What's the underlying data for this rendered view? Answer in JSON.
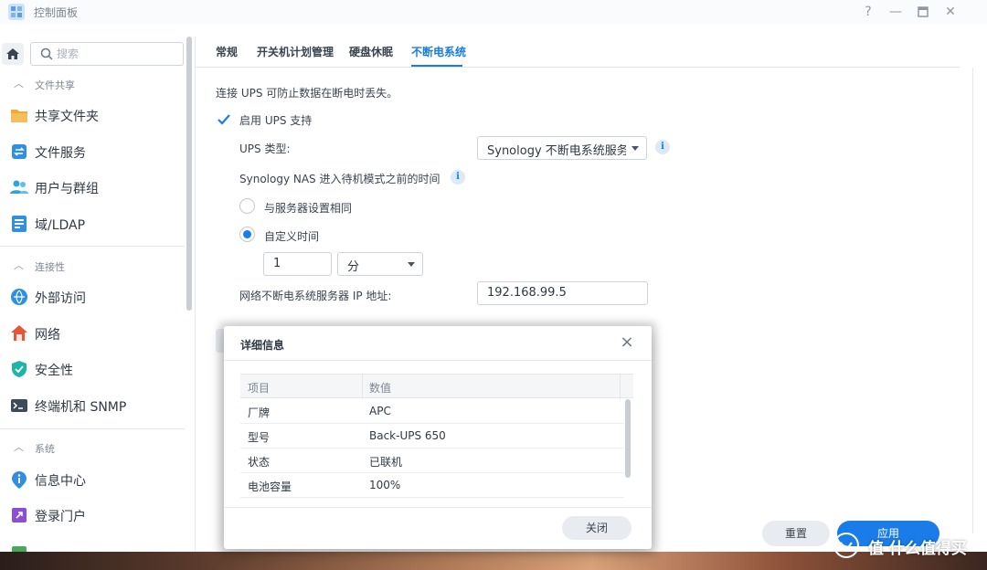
{
  "window": {
    "title": "控制面板"
  },
  "sidebar": {
    "search_placeholder": "搜索",
    "sections": [
      {
        "title": "文件共享",
        "items": [
          {
            "label": "共享文件夹",
            "icon": "folder-share-icon"
          },
          {
            "label": "文件服务",
            "icon": "file-services-icon"
          },
          {
            "label": "用户与群组",
            "icon": "users-group-icon"
          },
          {
            "label": "域/LDAP",
            "icon": "domain-ldap-icon"
          }
        ]
      },
      {
        "title": "连接性",
        "items": [
          {
            "label": "外部访问",
            "icon": "external-access-icon"
          },
          {
            "label": "网络",
            "icon": "network-icon"
          },
          {
            "label": "安全性",
            "icon": "shield-icon"
          },
          {
            "label": "终端机和 SNMP",
            "icon": "terminal-icon"
          }
        ]
      },
      {
        "title": "系统",
        "items": [
          {
            "label": "信息中心",
            "icon": "info-center-icon"
          },
          {
            "label": "登录门户",
            "icon": "login-portal-icon"
          }
        ]
      }
    ]
  },
  "tabs": [
    {
      "label": "常规",
      "active": false
    },
    {
      "label": "开关机计划管理",
      "active": false
    },
    {
      "label": "硬盘休眠",
      "active": false
    },
    {
      "label": "不断电系统",
      "active": true
    }
  ],
  "ups": {
    "description": "连接 UPS 可防止数据在断电时丢失。",
    "enable_label": "启用 UPS 支持",
    "type_label": "UPS 类型:",
    "type_value": "Synology 不断电系统服务器",
    "standby_label": "Synology NAS 进入待机模式之前的时间",
    "option_same": "与服务器设置相同",
    "option_custom": "自定义时间",
    "time_value": "1",
    "time_unit": "分",
    "server_ip_label": "网络不断电系统服务器 IP 地址:",
    "server_ip_value": "192.168.99.5"
  },
  "footer": {
    "reset": "重置",
    "apply": "应用"
  },
  "modal": {
    "title": "详细信息",
    "columns": [
      "项目",
      "数值"
    ],
    "rows": [
      {
        "item": "厂牌",
        "value": "APC"
      },
      {
        "item": "型号",
        "value": "Back-UPS 650"
      },
      {
        "item": "状态",
        "value": "已联机"
      },
      {
        "item": "电池容量",
        "value": "100%"
      }
    ],
    "close_label": "关闭"
  },
  "watermark": {
    "text": "值 什么值得买"
  },
  "colors": {
    "accent": "#1a7ce8"
  }
}
